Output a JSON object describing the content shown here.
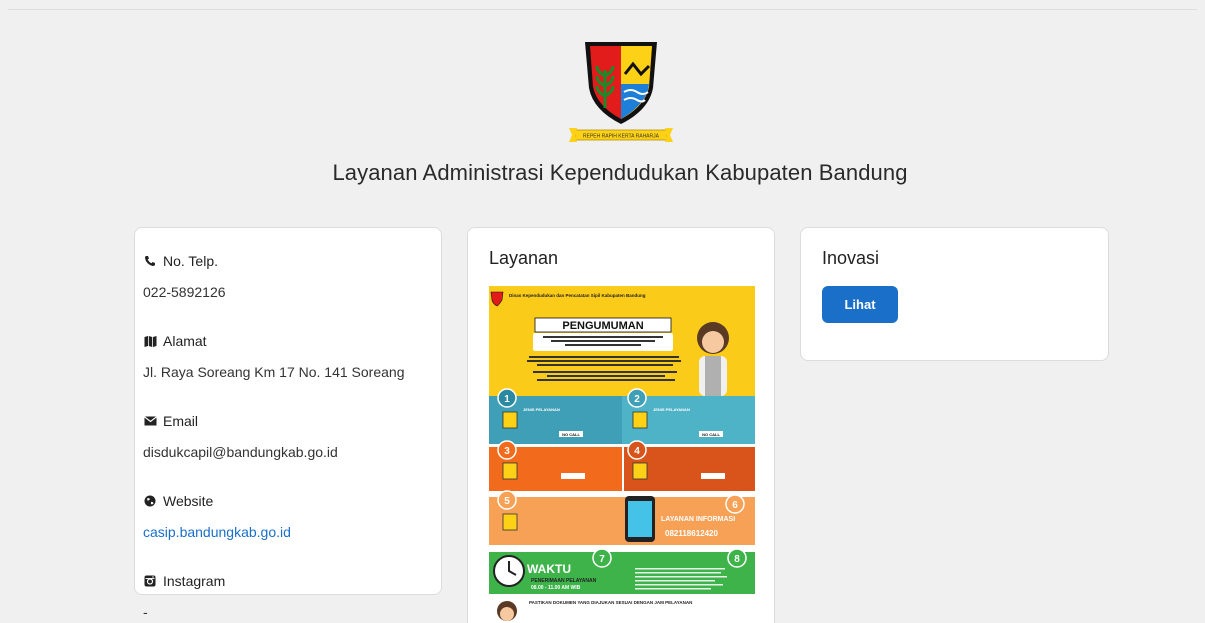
{
  "header": {
    "title": "Layanan Administrasi Kependudukan Kabupaten Bandung",
    "logo_motto": "REPEH RAPIH KERTA RAHARJA"
  },
  "contact": {
    "phone": {
      "label": "No. Telp.",
      "value": "022-5892126",
      "icon": "phone-icon"
    },
    "address": {
      "label": "Alamat",
      "value": "Jl. Raya Soreang Km 17 No. 141 Soreang",
      "icon": "map-icon"
    },
    "email": {
      "label": "Email",
      "value": "disdukcapil@bandungkab.go.id",
      "icon": "envelope-icon"
    },
    "website": {
      "label": "Website",
      "value": "casip.bandungkab.go.id",
      "icon": "globe-icon"
    },
    "instagram": {
      "label": "Instagram",
      "value": "-",
      "icon": "instagram-icon"
    }
  },
  "layanan": {
    "title": "Layanan",
    "poster": {
      "org": "Dinas Kependudukan dan Pencatatan Sipil Kabupaten Bandung",
      "heading": "PENGUMUMAN",
      "steps": [
        "1",
        "2",
        "3",
        "4",
        "5",
        "6",
        "7",
        "8"
      ],
      "step_label": "JENIS PELAYANAN",
      "no_call": "NO CALL",
      "info_title": "LAYANAN INFORMASI",
      "info_number": "082118612420",
      "waktu": "WAKTU",
      "waktu_sub": "PENERIMAAN PELAYANAN",
      "waktu_hours": "08.00 - 11.00 AM WIB",
      "footer_note": "PASTIKAN DOKUMEN YANG DIAJUKAN SESUAI DENGAN JAM PELAYANAN"
    }
  },
  "inovasi": {
    "title": "Inovasi",
    "button_label": "Lihat"
  },
  "colors": {
    "accent": "#1a6fc9",
    "poster_yellow": "#fbcb1a",
    "poster_teal": "#4fb3c8",
    "poster_orange": "#f26b1d",
    "poster_peach": "#f7a157",
    "poster_green": "#3db34a"
  }
}
